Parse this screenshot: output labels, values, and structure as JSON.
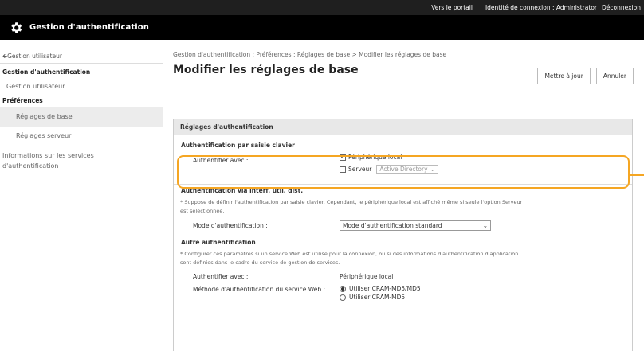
{
  "topbar": {
    "portal_link": "Vers le portail",
    "login_id_label": "Identité de connexion :",
    "login_id_value": "Administrator",
    "logout_link": "Déconnexion"
  },
  "app": {
    "title": "Gestion d'authentification",
    "icon": "gear-icon"
  },
  "sidebar": {
    "back_link": "Gestion utilisateur",
    "section_title": "Gestion d'authentification",
    "user_management": "Gestion utilisateur",
    "preferences_title": "Préférences",
    "basic_settings": "Réglages de base",
    "server_settings": "Réglages serveur",
    "service_info_line1": "Informations sur les services",
    "service_info_line2": "d'authentification"
  },
  "main": {
    "breadcrumb": "Gestion d'authentification : Préférences : Réglages de base > Modifier les réglages de base",
    "title": "Modifier les réglages de base",
    "update_button": "Mettre à jour",
    "cancel_button": "Annuler"
  },
  "panel": {
    "header": "Réglages d'authentification",
    "keyboard_section": {
      "title": "Authentification par saisie clavier",
      "authenticate_with_label": "Authentifier avec :",
      "local_device_label": "Périphérique local",
      "local_device_checked": true,
      "server_label": "Serveur",
      "server_checked": false,
      "server_type_value": "Active Directory"
    },
    "remote_ui_section": {
      "title": "Authentification via interf. util. dist.",
      "note_line1": "* Suppose de définir l'authentification par saisie clavier. Cependant, le périphérique local est affiché même si seule l'option Serveur",
      "note_line2": "est sélectionnée.",
      "auth_mode_label": "Mode d'authentification :",
      "auth_mode_value": "Mode d'authentification standard"
    },
    "other_section": {
      "title": "Autre authentification",
      "note_line1": "* Configurer ces paramètres si un service Web est utilisé pour la connexion, ou si des informations d'authentification d'application",
      "note_line2": "sont définies dans le cadre du service de gestion de services.",
      "authenticate_with_label": "Authentifier avec :",
      "authenticate_with_value": "Périphérique local",
      "web_service_method_label": "Méthode d'authentification du service Web :",
      "option_1": "Utiliser CRAM-MD5/MD5",
      "option_1_selected": true,
      "option_2": "Utiliser CRAM-MD5",
      "option_2_selected": false
    }
  },
  "colors": {
    "topbar_bg": "#1f1f1f",
    "titlebar_bg": "#000000",
    "highlight": "#f5a623",
    "panel_header_bg": "#e8e8e8"
  }
}
